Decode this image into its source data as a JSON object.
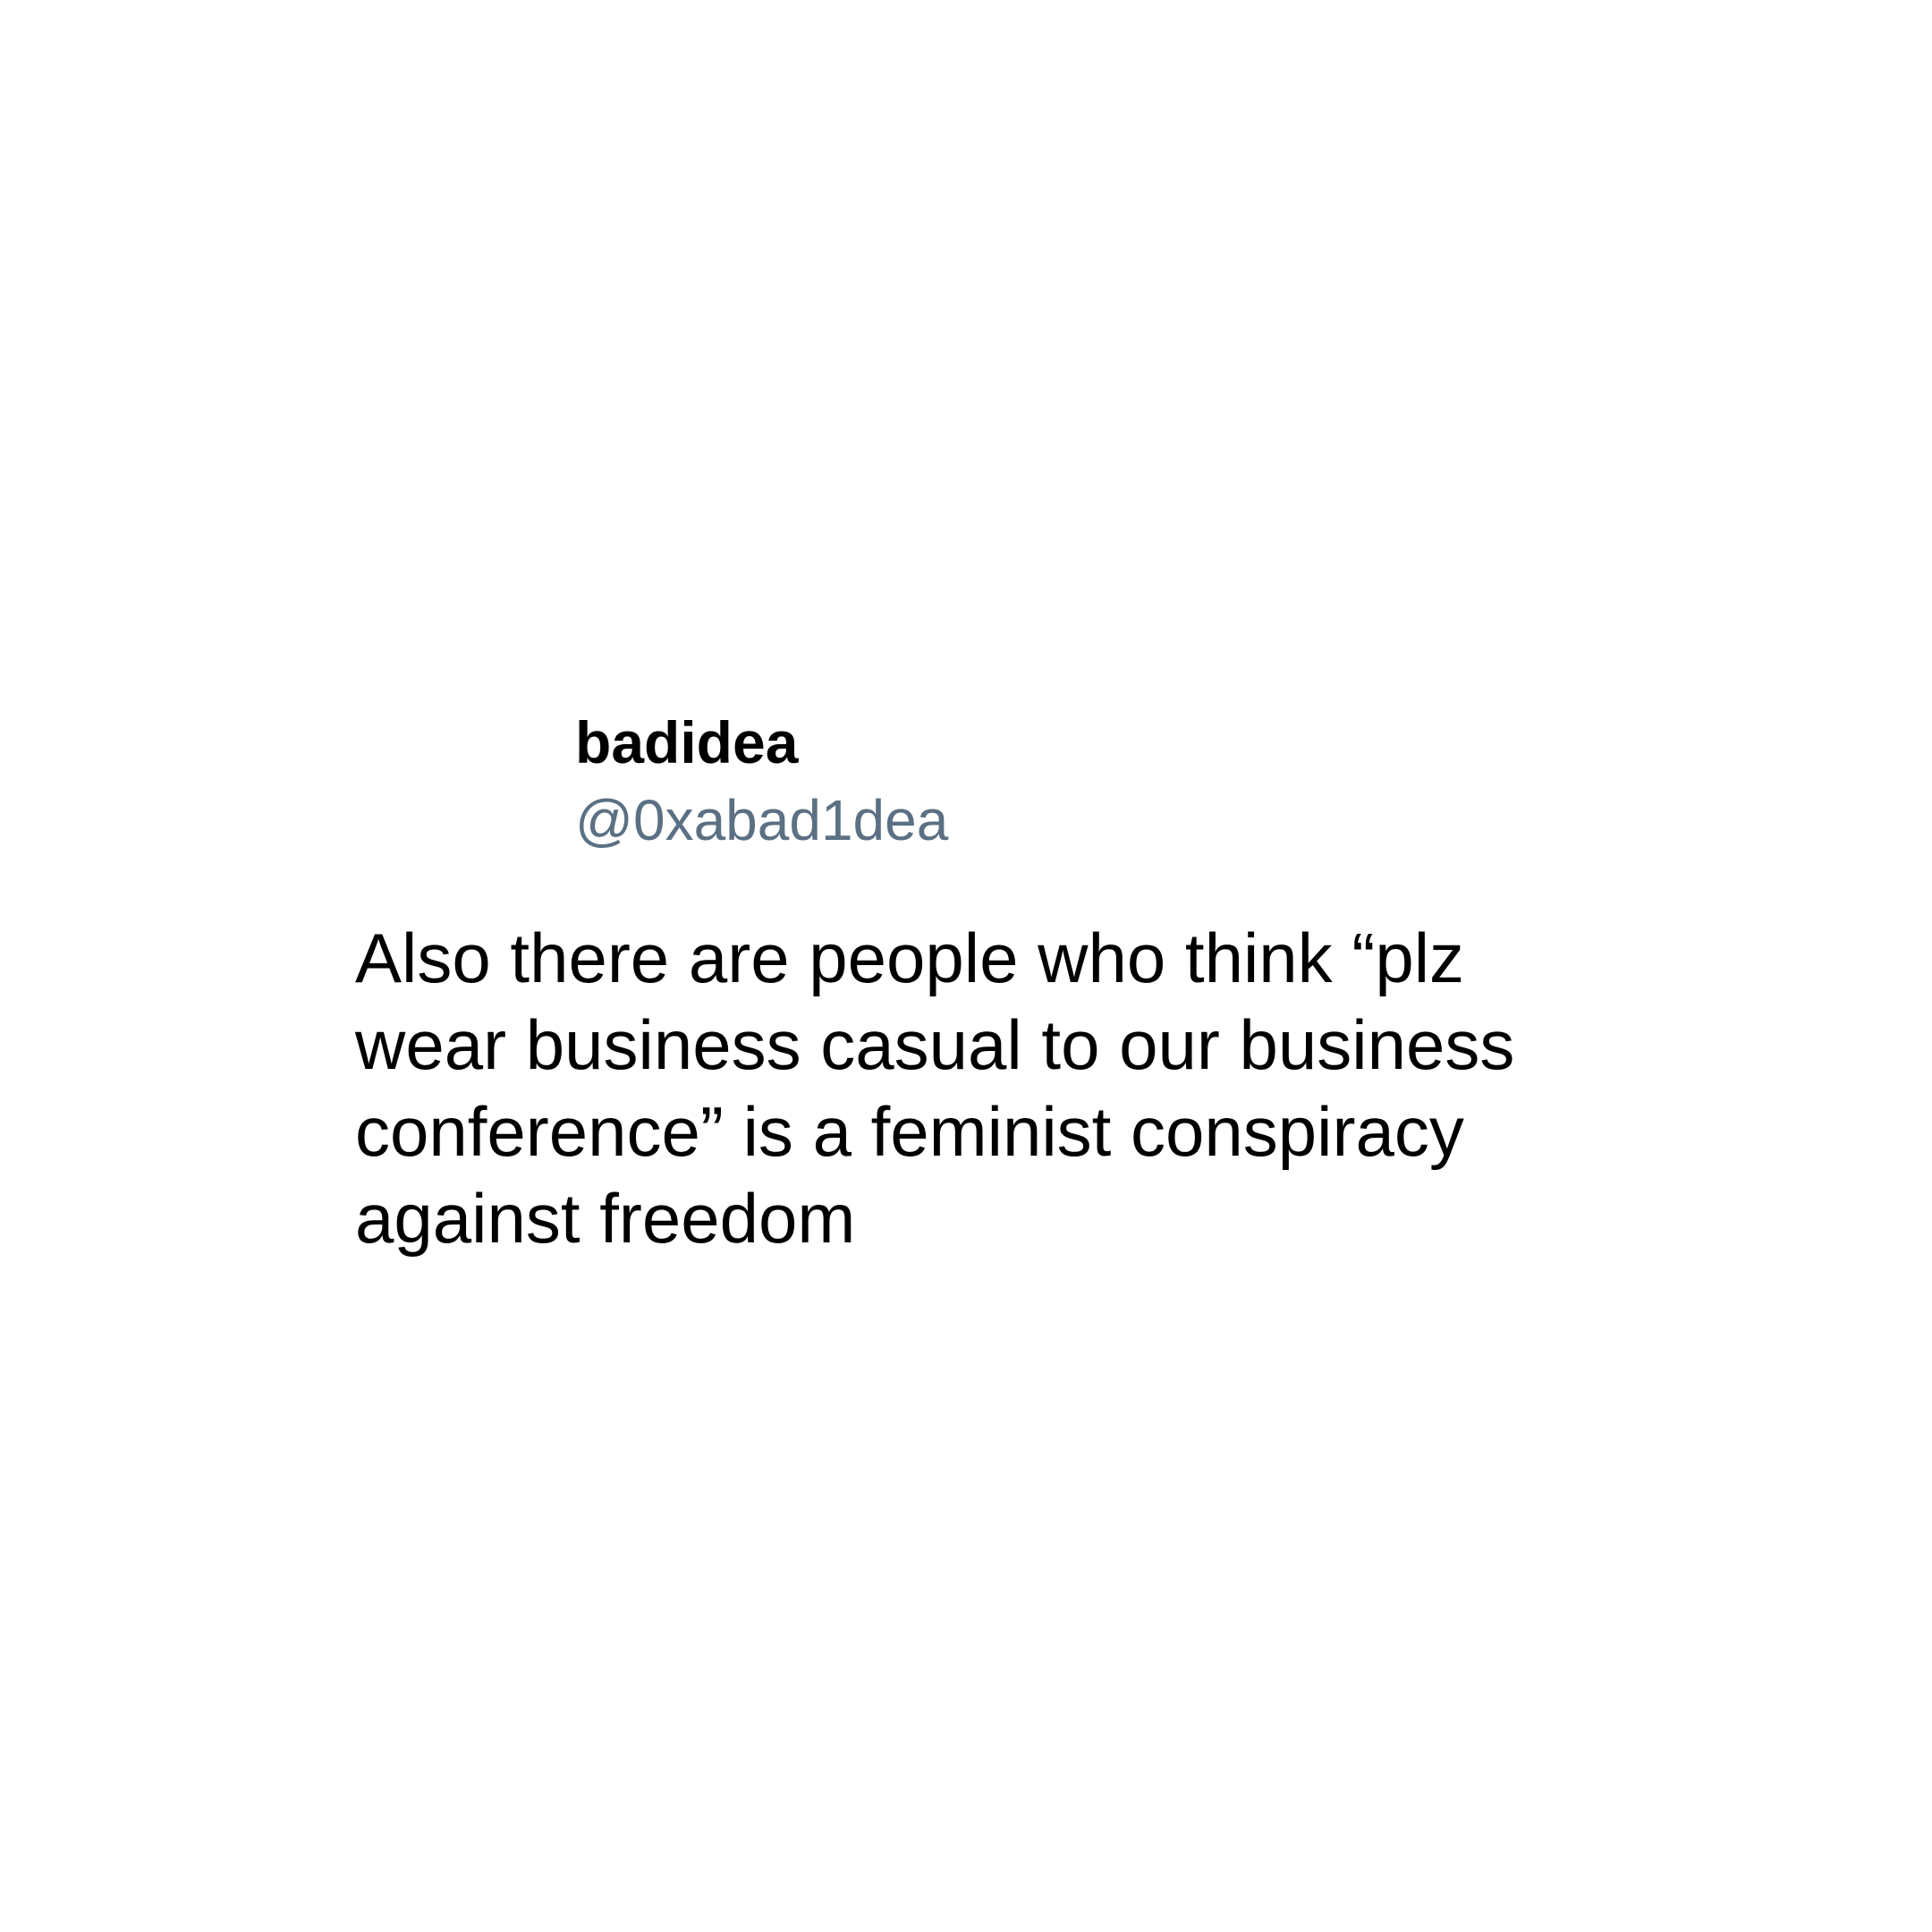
{
  "tweet": {
    "author": {
      "display_name": "badidea",
      "handle": "@0xabad1dea"
    },
    "text_lines": [
      "Also there are people who think “plz",
      "wear business casual to our business",
      "conference” is a feminist conspiracy",
      "against freedom"
    ]
  },
  "colors": {
    "background": "#ffffff",
    "name": "#000000",
    "handle": "#5b7083",
    "text": "#000000"
  }
}
